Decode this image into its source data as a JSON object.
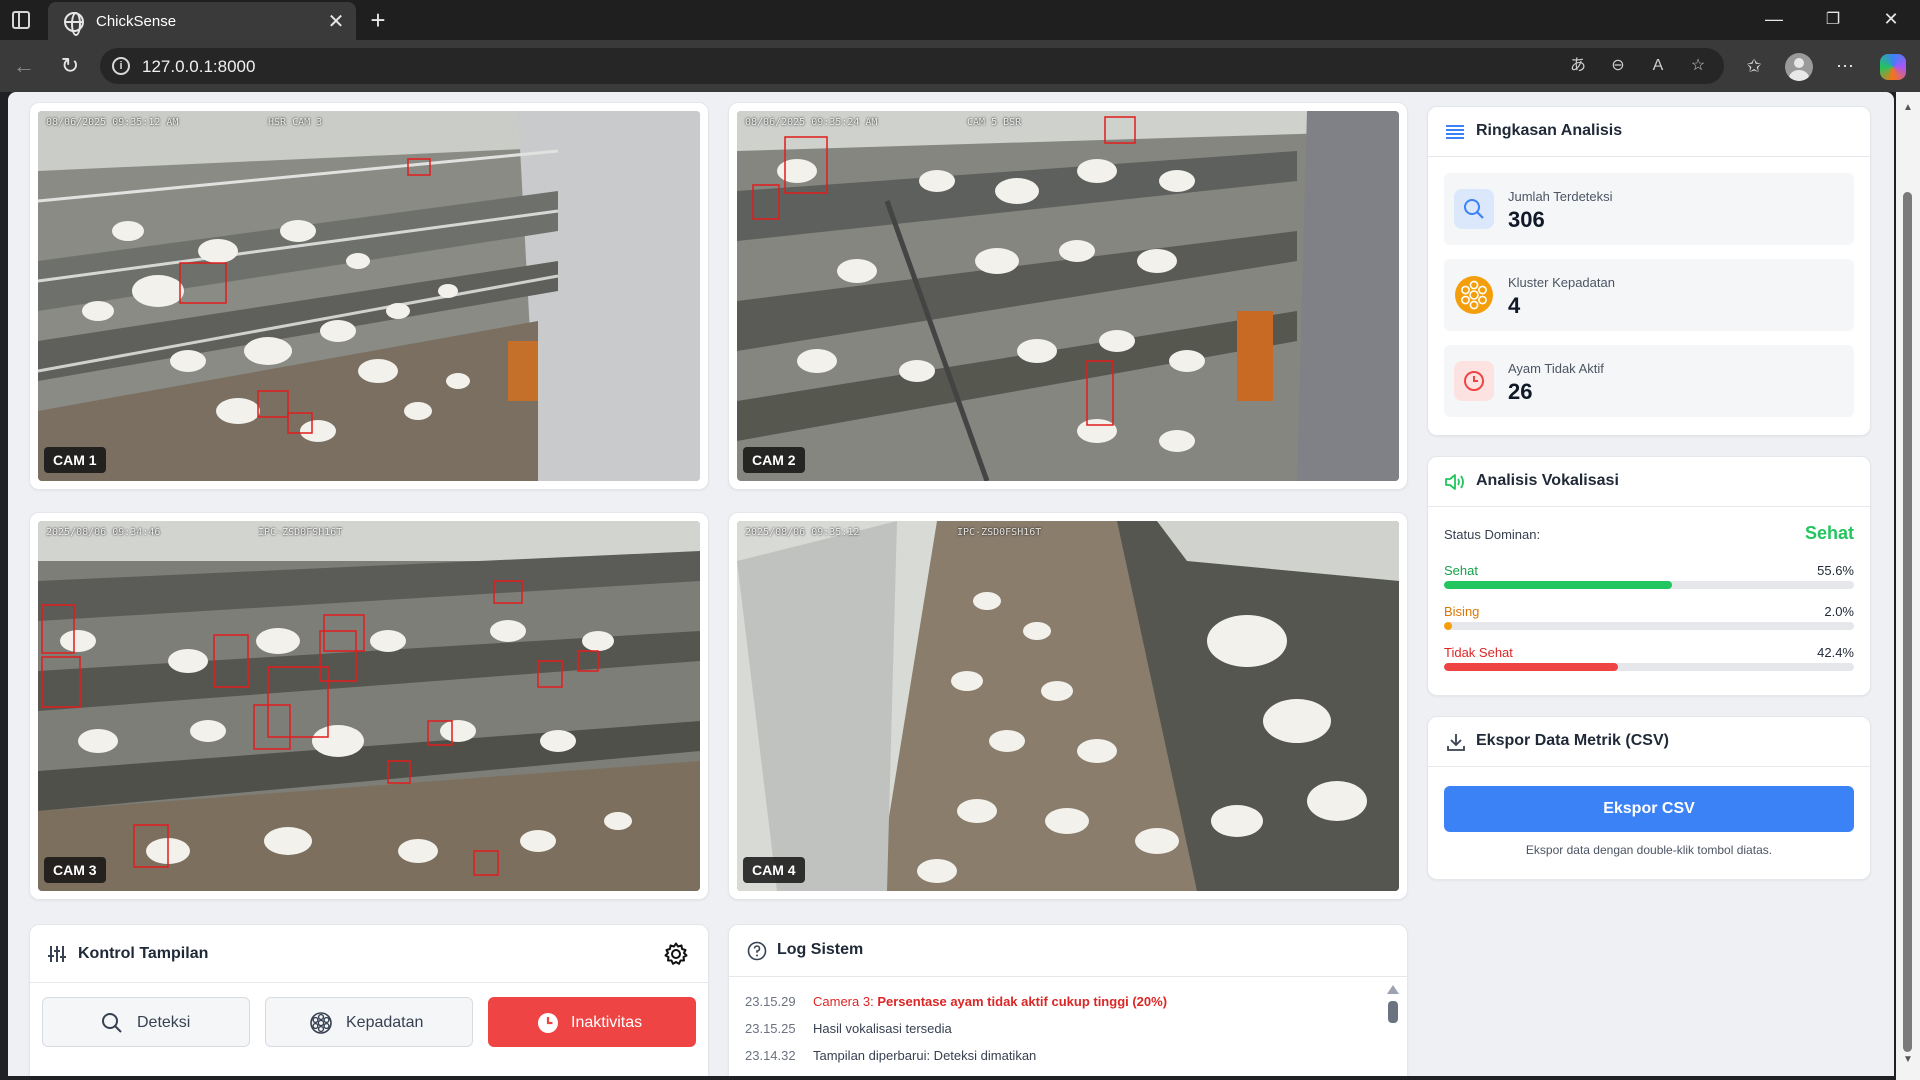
{
  "browser": {
    "tab_title": "ChickSense",
    "url": "127.0.0.1:8000"
  },
  "cameras": [
    {
      "label": "CAM 1",
      "stamp": "08/06/2025 09:35:12 AM",
      "stamp2": "HSR CAM 3"
    },
    {
      "label": "CAM 2",
      "stamp": "08/06/2025 09:35:24 AM",
      "stamp2": "CAM 5 BSR"
    },
    {
      "label": "CAM 3",
      "stamp": "2025/08/06 09:34:46",
      "stamp2": "IPC-ZSD0FSH16T"
    },
    {
      "label": "CAM 4",
      "stamp": "2025/08/06 09:35:12",
      "stamp2": "IPC-ZSD0FSH16T"
    }
  ],
  "summary": {
    "title": "Ringkasan Analisis",
    "stats": [
      {
        "label": "Jumlah Terdeteksi",
        "value": "306",
        "icon": "search-icon",
        "color": "#3b82f6"
      },
      {
        "label": "Kluster Kepadatan",
        "value": "4",
        "icon": "cluster-icon",
        "color": "#f59e0b"
      },
      {
        "label": "Ayam Tidak Aktif",
        "value": "26",
        "icon": "clock-icon",
        "color": "#ef4444"
      }
    ]
  },
  "vocal": {
    "title": "Analisis Vokalisasi",
    "dominant_label": "Status Dominan:",
    "dominant_value": "Sehat",
    "rows": [
      {
        "label": "Sehat",
        "pct_text": "55.6%",
        "pct": 55.6,
        "color": "#22c55e"
      },
      {
        "label": "Bising",
        "pct_text": "2.0%",
        "pct": 2.0,
        "color": "#f59e0b"
      },
      {
        "label": "Tidak Sehat",
        "pct_text": "42.4%",
        "pct": 42.4,
        "color": "#ef4444"
      }
    ]
  },
  "export": {
    "title": "Ekspor Data Metrik (CSV)",
    "button": "Ekspor CSV",
    "note": "Ekspor data dengan double-klik tombol diatas."
  },
  "controls": {
    "title": "Kontrol Tampilan",
    "buttons": [
      {
        "label": "Deteksi",
        "active": false
      },
      {
        "label": "Kepadatan",
        "active": false
      },
      {
        "label": "Inaktivitas",
        "active": true
      }
    ]
  },
  "log": {
    "title": "Log Sistem",
    "entries": [
      {
        "time": "23.15.29",
        "camera": "Camera 3:",
        "message": "Persentase ayam tidak aktif cukup tinggi (20%)"
      },
      {
        "time": "23.15.25",
        "message": "Hasil vokalisasi tersedia"
      },
      {
        "time": "23.14.32",
        "message": "Tampilan diperbarui: Deteksi dimatikan"
      }
    ]
  },
  "colors": {
    "accent_blue": "#3b82f6",
    "status_green": "#22c55e",
    "status_red": "#ef4444",
    "status_amber": "#f59e0b"
  }
}
